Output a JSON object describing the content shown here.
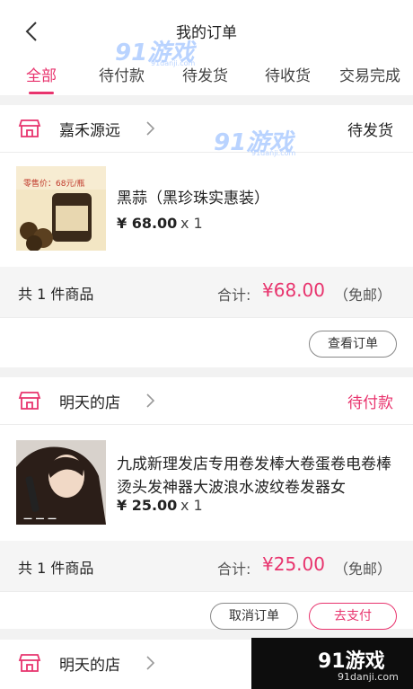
{
  "header": {
    "title": "我的订单"
  },
  "tabs": [
    {
      "label": "全部"
    },
    {
      "label": "待付款"
    },
    {
      "label": "待发货"
    },
    {
      "label": "待收货"
    },
    {
      "label": "交易完成"
    }
  ],
  "accent_color": "#e8336d",
  "orders": [
    {
      "shop": "嘉禾源远",
      "status": "待发货",
      "status_color": "#222222",
      "product": {
        "name": "黑蒜（黑珍珠实惠装）",
        "price": "¥ 68.00",
        "qty": "x 1",
        "thumb_caption": "零售价：68元/瓶"
      },
      "summary": {
        "count": "共 1 件商品",
        "label": "合计:",
        "amount": "¥68.00",
        "shipping": "（免邮）"
      },
      "buttons": [
        "查看订单"
      ]
    },
    {
      "shop": "明天的店",
      "status": "待付款",
      "status_color": "#e8336d",
      "product": {
        "name": "九成新理发店专用卷发棒大卷蛋卷电卷棒烫头发神器大波浪水波纹卷发器女",
        "price": "¥ 25.00",
        "qty": "x 1"
      },
      "summary": {
        "count": "共 1 件商品",
        "label": "合计:",
        "amount": "¥25.00",
        "shipping": "（免邮）"
      },
      "buttons": [
        "取消订单",
        "去支付"
      ]
    },
    {
      "shop": "明天的店"
    }
  ],
  "watermark": {
    "text": "91游戏",
    "site": "91danji.com"
  }
}
